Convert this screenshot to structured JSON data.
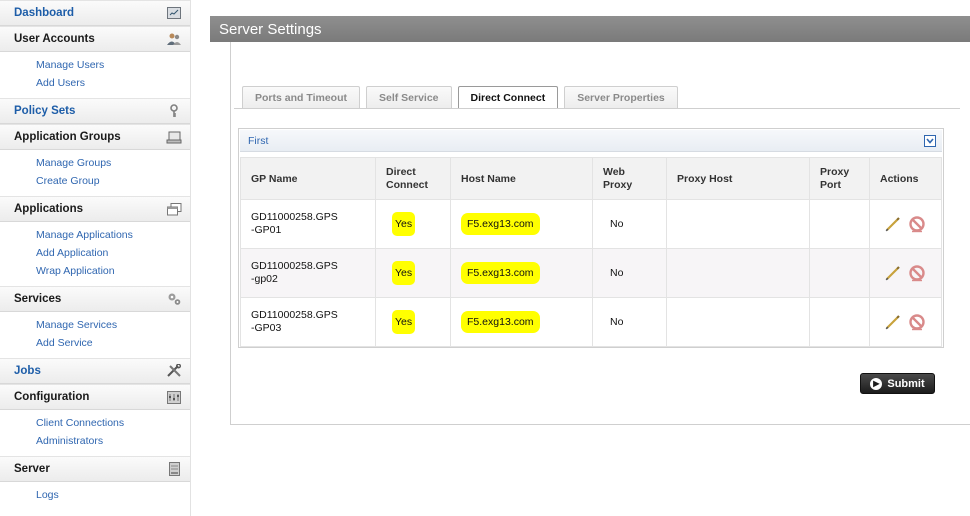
{
  "sidebar": {
    "sections": [
      {
        "label": "Dashboard",
        "icon": "dashboard-icon",
        "blue": true,
        "items": []
      },
      {
        "label": "User Accounts",
        "icon": "users-icon",
        "blue": false,
        "items": [
          "Manage Users",
          "Add Users"
        ]
      },
      {
        "label": "Policy Sets",
        "icon": "key-icon",
        "blue": true,
        "items": []
      },
      {
        "label": "Application Groups",
        "icon": "monitor-icon",
        "blue": false,
        "items": [
          "Manage Groups",
          "Create Group"
        ]
      },
      {
        "label": "Applications",
        "icon": "windows-icon",
        "blue": false,
        "items": [
          "Manage Applications",
          "Add Application",
          "Wrap Application"
        ]
      },
      {
        "label": "Services",
        "icon": "gears-icon",
        "blue": false,
        "items": [
          "Manage Services",
          "Add Service"
        ]
      },
      {
        "label": "Jobs",
        "icon": "tools-icon",
        "blue": true,
        "items": []
      },
      {
        "label": "Configuration",
        "icon": "config-icon",
        "blue": false,
        "items": [
          "Client Connections",
          "Administrators"
        ]
      },
      {
        "label": "Server",
        "icon": "server-icon",
        "blue": false,
        "items": [
          "Logs"
        ]
      }
    ]
  },
  "header": {
    "title": "Server Settings"
  },
  "tabs": [
    {
      "label": "Ports and Timeout",
      "active": false
    },
    {
      "label": "Self Service",
      "active": false
    },
    {
      "label": "Direct Connect",
      "active": true
    },
    {
      "label": "Server Properties",
      "active": false
    }
  ],
  "group": {
    "title": "First"
  },
  "table": {
    "headers": [
      "GP Name",
      "Direct Connect",
      "Host Name",
      "Web Proxy",
      "Proxy Host",
      "Proxy Port",
      "Actions"
    ],
    "rows": [
      {
        "gp_name": "GD11000258.GPS-GP01",
        "direct_connect": "Yes",
        "host_name": "F5.exg13.com",
        "web_proxy": "No",
        "proxy_host": "",
        "proxy_port": ""
      },
      {
        "gp_name": "GD11000258.GPS-gp02",
        "direct_connect": "Yes",
        "host_name": "F5.exg13.com",
        "web_proxy": "No",
        "proxy_host": "",
        "proxy_port": ""
      },
      {
        "gp_name": "GD11000258.GPS-GP03",
        "direct_connect": "Yes",
        "host_name": "F5.exg13.com",
        "web_proxy": "No",
        "proxy_host": "",
        "proxy_port": ""
      }
    ]
  },
  "submit_label": "Submit",
  "colors": {
    "header_bg": "#858585",
    "link": "#2f66b0",
    "highlight": "#ffff00",
    "delete_icon": "#d98a8a",
    "edit_icon": "#c8a23c"
  }
}
